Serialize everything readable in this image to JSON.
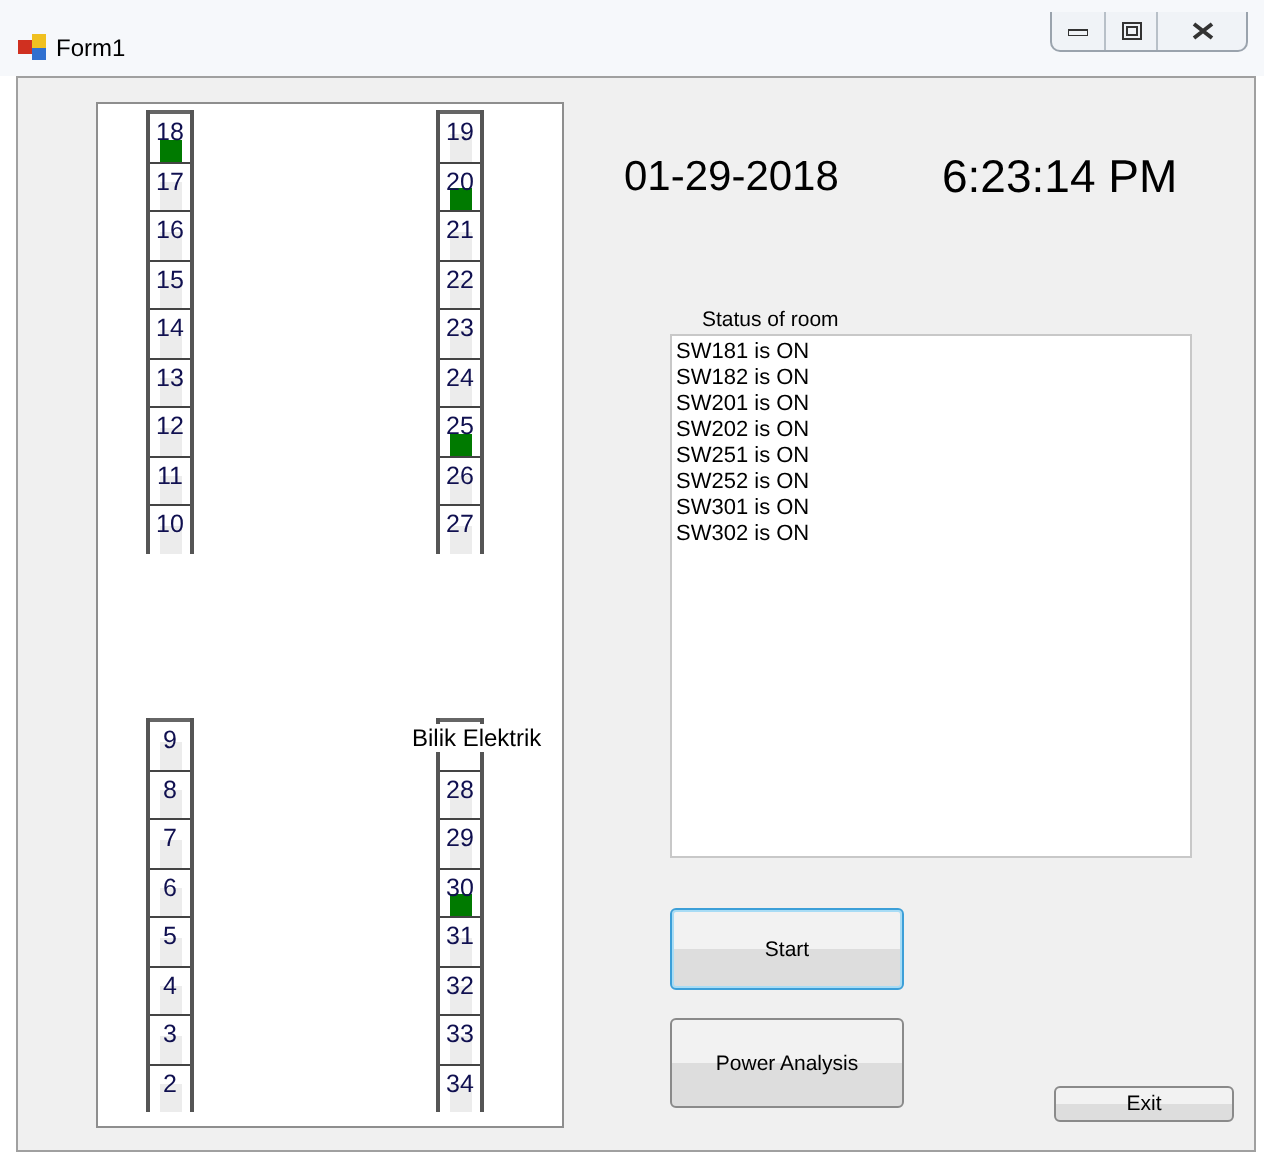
{
  "window": {
    "title": "Form1"
  },
  "floor_plan": {
    "label": "Bilik Elektrik",
    "blocks": [
      {
        "columns": [
          {
            "rooms": [
              {
                "kind": "room",
                "number": "18",
                "on": true
              },
              {
                "kind": "room",
                "number": "17",
                "on": false
              },
              {
                "kind": "room",
                "number": "16",
                "on": false
              },
              {
                "kind": "room",
                "number": "15",
                "on": false
              },
              {
                "kind": "room",
                "number": "14",
                "on": false
              },
              {
                "kind": "room",
                "number": "13",
                "on": false
              },
              {
                "kind": "room",
                "number": "12",
                "on": false
              },
              {
                "kind": "room",
                "number": "11",
                "on": false
              },
              {
                "kind": "room",
                "number": "10",
                "on": false
              }
            ]
          },
          {
            "rooms": [
              {
                "kind": "room",
                "number": "19",
                "on": false
              },
              {
                "kind": "room",
                "number": "20",
                "on": true
              },
              {
                "kind": "room",
                "number": "21",
                "on": false
              },
              {
                "kind": "room",
                "number": "22",
                "on": false
              },
              {
                "kind": "room",
                "number": "23",
                "on": false
              },
              {
                "kind": "room",
                "number": "24",
                "on": false
              },
              {
                "kind": "room",
                "number": "25",
                "on": true
              },
              {
                "kind": "room",
                "number": "26",
                "on": false
              },
              {
                "kind": "room",
                "number": "27",
                "on": false
              }
            ]
          }
        ]
      },
      {
        "columns": [
          {
            "rooms": [
              {
                "kind": "room",
                "number": "9",
                "on": false
              },
              {
                "kind": "room",
                "number": "8",
                "on": false
              },
              {
                "kind": "room",
                "number": "7",
                "on": false
              },
              {
                "kind": "room",
                "number": "6",
                "on": false
              },
              {
                "kind": "room",
                "number": "5",
                "on": false
              },
              {
                "kind": "room",
                "number": "4",
                "on": false
              },
              {
                "kind": "room",
                "number": "3",
                "on": false
              },
              {
                "kind": "room",
                "number": "2",
                "on": false
              }
            ]
          },
          {
            "rooms": [
              {
                "kind": "blank"
              },
              {
                "kind": "room",
                "number": "28",
                "on": false
              },
              {
                "kind": "room",
                "number": "29",
                "on": false
              },
              {
                "kind": "room",
                "number": "30",
                "on": true
              },
              {
                "kind": "room",
                "number": "31",
                "on": false
              },
              {
                "kind": "room",
                "number": "32",
                "on": false
              },
              {
                "kind": "room",
                "number": "33",
                "on": false
              },
              {
                "kind": "room",
                "number": "34",
                "on": false
              }
            ]
          }
        ]
      }
    ]
  },
  "date": "01-29-2018",
  "time": "6:23:14 PM",
  "status": {
    "label": "Status of room",
    "lines": [
      "SW181 is ON",
      "SW182 is ON",
      "SW201 is ON",
      "SW202 is ON",
      "SW251 is ON",
      "SW252 is ON",
      "SW301 is ON",
      "SW302 is ON"
    ]
  },
  "buttons": [
    {
      "label": "Start",
      "focused": true
    },
    {
      "label": "Power Analysis",
      "focused": false
    }
  ],
  "exit_button": {
    "label": "Exit"
  }
}
